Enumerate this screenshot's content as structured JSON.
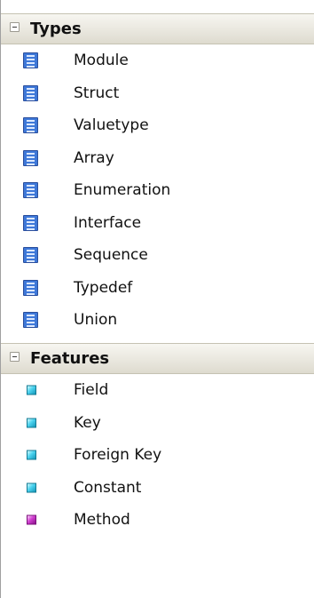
{
  "toolbox": {
    "sections": [
      {
        "title": "Types",
        "expanded": true,
        "toggle_icon": "minus-box-icon",
        "items": [
          {
            "label": "Module",
            "icon": "type-document-icon"
          },
          {
            "label": "Struct",
            "icon": "type-document-icon"
          },
          {
            "label": "Valuetype",
            "icon": "type-document-icon"
          },
          {
            "label": "Array",
            "icon": "type-document-icon"
          },
          {
            "label": "Enumeration",
            "icon": "type-document-icon"
          },
          {
            "label": "Interface",
            "icon": "type-document-icon"
          },
          {
            "label": "Sequence",
            "icon": "type-document-icon"
          },
          {
            "label": "Typedef",
            "icon": "type-document-icon"
          },
          {
            "label": "Union",
            "icon": "type-document-icon"
          }
        ]
      },
      {
        "title": "Features",
        "expanded": true,
        "toggle_icon": "minus-box-icon",
        "items": [
          {
            "label": "Field",
            "icon": "cyan-diamond-icon",
            "color": "#2bb7d8"
          },
          {
            "label": "Key",
            "icon": "cyan-diamond-icon",
            "color": "#2bb7d8"
          },
          {
            "label": "Foreign Key",
            "icon": "cyan-diamond-icon",
            "color": "#2bb7d8"
          },
          {
            "label": "Constant",
            "icon": "cyan-diamond-icon",
            "color": "#2bb7d8"
          },
          {
            "label": "Method",
            "icon": "magenta-diamond-icon",
            "color": "#c21ec2"
          }
        ]
      }
    ]
  }
}
